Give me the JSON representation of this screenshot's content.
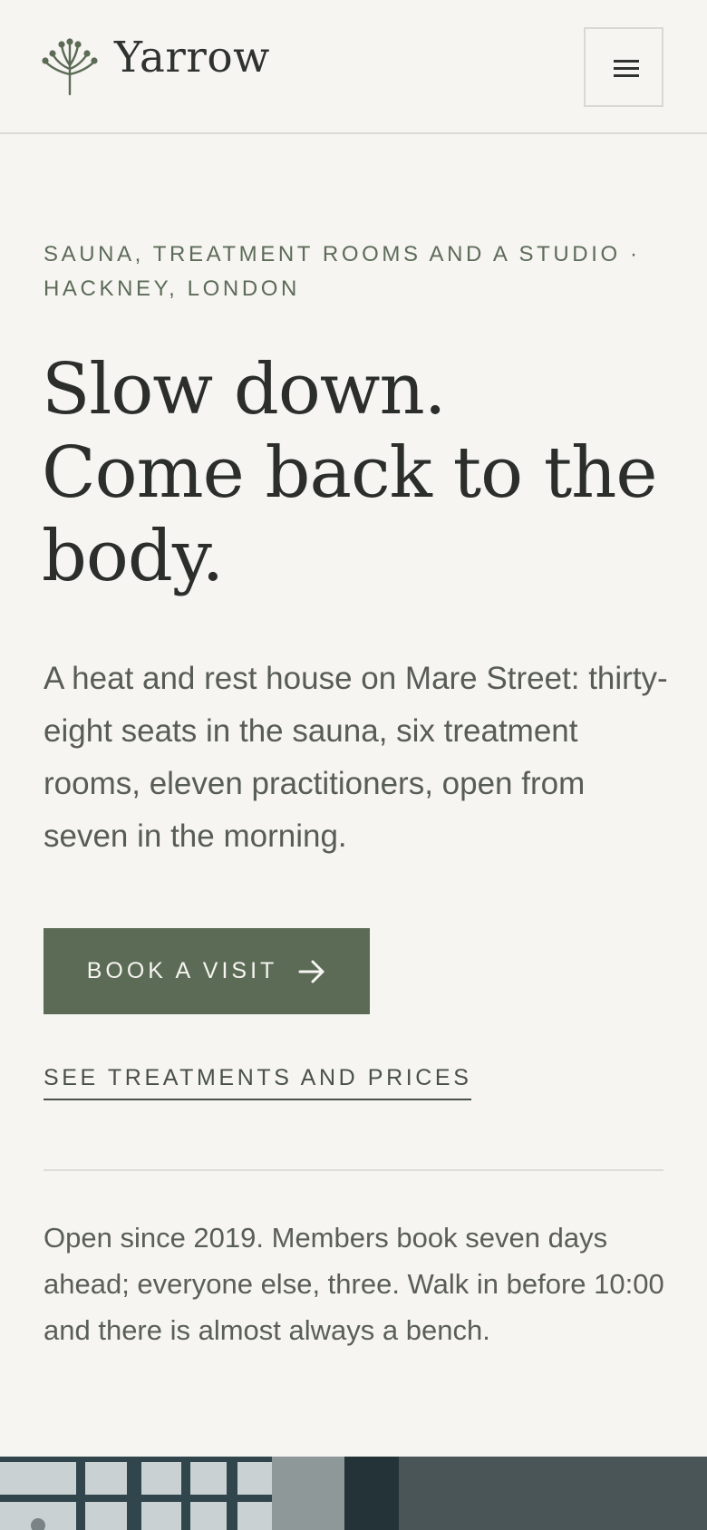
{
  "header": {
    "brand": "Yarrow",
    "logo_icon": "yarrow-flower-icon",
    "menu_icon": "hamburger-menu-icon"
  },
  "hero": {
    "eyebrow": "SAUNA, TREATMENT ROOMS AND A STUDIO · HACKNEY, LONDON",
    "headline_lines": [
      "Slow down.",
      "Come back to the",
      "body."
    ],
    "intro": "A heat and rest house on Mare Street: thirty-eight seats in the sauna, six treatment rooms, eleven practitioners, open from seven in the morning.",
    "cta_label": "BOOK A VISIT",
    "cta_icon": "arrow-right-icon",
    "secondary_link": "SEE TREATMENTS AND PRICES",
    "note": "Open since 2019. Members book seven days ahead; everyone else, three. Walk in before 10:00 and there is almost always a bench."
  },
  "colors": {
    "background": "#f6f5f1",
    "accent": "#5b6b55",
    "text": "#2b2e2a",
    "muted_text": "#585c57"
  }
}
